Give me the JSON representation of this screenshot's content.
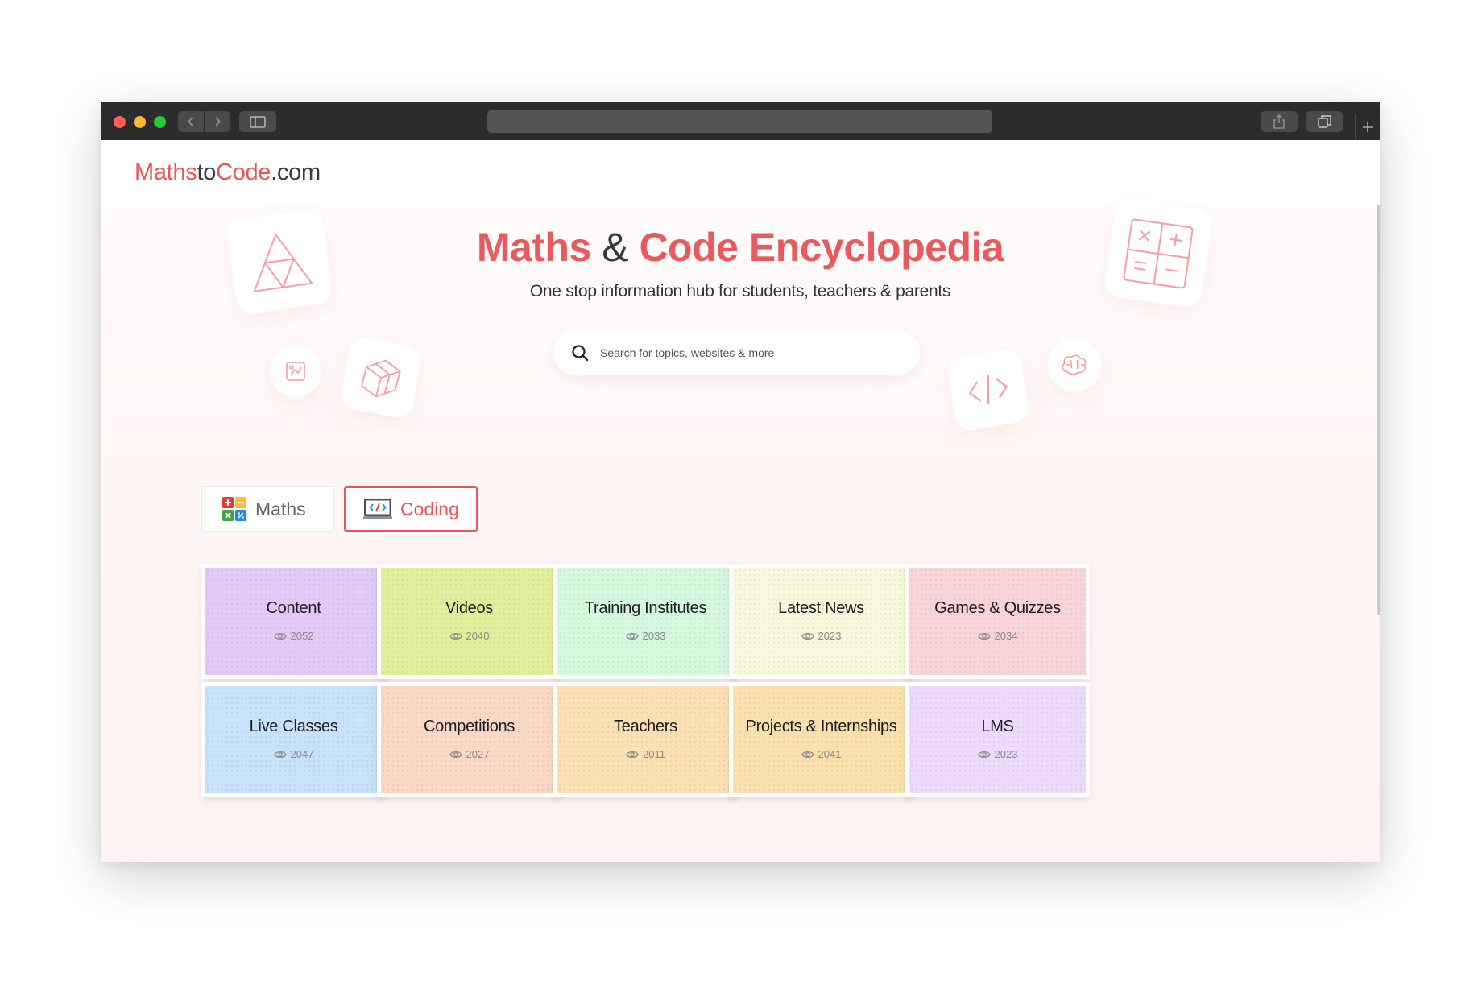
{
  "browser": {
    "traffic_colors": [
      "#ff5f57",
      "#febc2e",
      "#28c840"
    ],
    "url": ""
  },
  "site": {
    "logo": {
      "part1": "Maths",
      "part2": "to",
      "part3": "Code",
      "part4": ".com"
    },
    "accent_color": "#e8565a"
  },
  "hero": {
    "title_part1": "Maths",
    "title_amp": "&",
    "title_part2": "Code Encyclopedia",
    "subtitle": "One stop information hub for students, teachers & parents"
  },
  "search": {
    "placeholder": "Search for topics, websites & more",
    "icon": "search-icon"
  },
  "toggles": [
    {
      "label": "Maths",
      "icon": "calculator-icon",
      "active": false
    },
    {
      "label": "Coding",
      "icon": "code-monitor-icon",
      "active": true
    }
  ],
  "cards": [
    {
      "title": "Content",
      "views": "2052",
      "color": "#e3c9f7"
    },
    {
      "title": "Videos",
      "views": "2040",
      "color": "#e2ee9c"
    },
    {
      "title": "Training Institutes",
      "views": "2033",
      "color": "#d5f8de"
    },
    {
      "title": "Latest News",
      "views": "2023",
      "color": "#f8f8dc"
    },
    {
      "title": "Games & Quizzes",
      "views": "2034",
      "color": "#f8d3d8"
    },
    {
      "title": "Live Classes",
      "views": "2047",
      "color": "#c8e2fa"
    },
    {
      "title": "Competitions",
      "views": "2027",
      "color": "#f9d8c6"
    },
    {
      "title": "Teachers",
      "views": "2011",
      "color": "#fae0b2"
    },
    {
      "title": "Projects & Internships",
      "views": "2041",
      "color": "#fae0ad"
    },
    {
      "title": "LMS",
      "views": "2023",
      "color": "#eddafb"
    }
  ]
}
